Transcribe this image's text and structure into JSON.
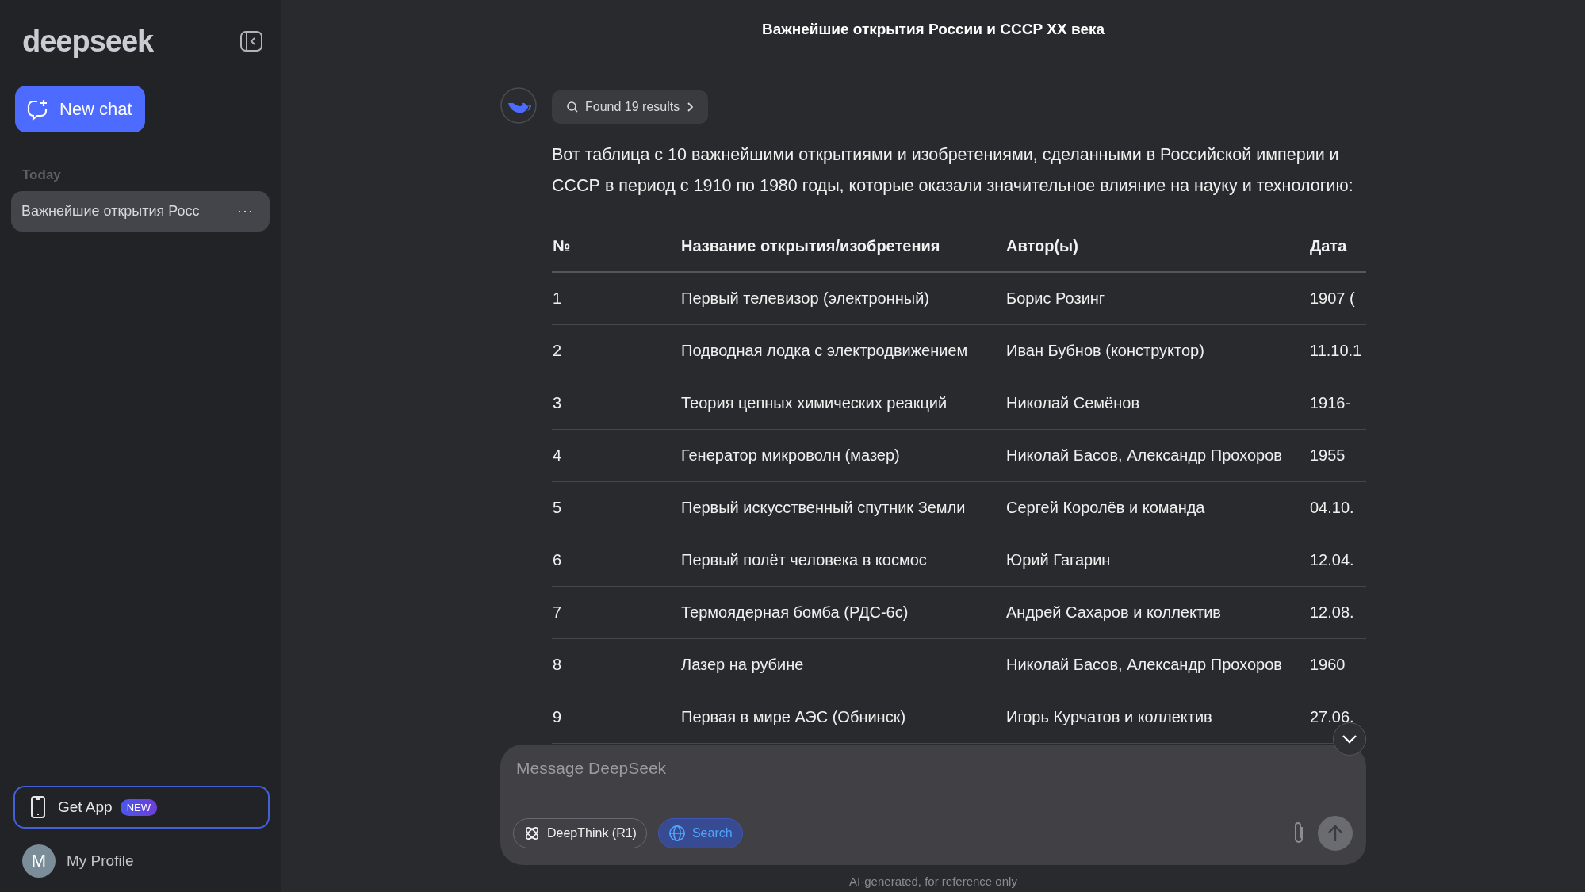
{
  "sidebar": {
    "logo": "deepseek",
    "new_chat": "New chat",
    "section": "Today",
    "history": [
      {
        "title": "Важнейшие открытия Росс",
        "selected": true,
        "menu": "···"
      }
    ],
    "get_app": {
      "label": "Get App",
      "badge": "NEW"
    },
    "profile": {
      "initial": "M",
      "name": "My Profile"
    }
  },
  "chat": {
    "title": "Важнейшие открытия России и СССР XX века",
    "search_chip": "Found 19 results",
    "intro": "Вот таблица с 10 важнейшими открытиями и изобретениями, сделанными в Российской империи и СССР в период с 1910 по 1980 годы, которые оказали значительное влияние на науку и технологию:",
    "table": {
      "columns": [
        "№",
        "Название открытия/изобретения",
        "Автор(ы)",
        "Дата"
      ],
      "rows": [
        [
          "1",
          "Первый телевизор (электронный)",
          "Борис Розинг",
          "1907 ("
        ],
        [
          "2",
          "Подводная лодка с электродвижением",
          "Иван Бубнов (конструктор)",
          "11.10.1"
        ],
        [
          "3",
          "Теория цепных химических реакций",
          "Николай Семёнов",
          "1916-"
        ],
        [
          "4",
          "Генератор микроволн (мазер)",
          "Николай Басов, Александр Прохоров",
          "1955"
        ],
        [
          "5",
          "Первый искусственный спутник Земли",
          "Сергей Королёв и команда",
          "04.10."
        ],
        [
          "6",
          "Первый полёт человека в космос",
          "Юрий Гагарин",
          "12.04."
        ],
        [
          "7",
          "Термоядерная бомба (РДС-6с)",
          "Андрей Сахаров и коллектив",
          "12.08."
        ],
        [
          "8",
          "Лазер на рубине",
          "Николай Басов, Александр Прохоров",
          "1960"
        ],
        [
          "9",
          "Первая в мире АЭС (Обнинск)",
          "Игорь Курчатов и коллектив",
          "27.06."
        ]
      ]
    }
  },
  "composer": {
    "placeholder": "Message DeepSeek",
    "toggles": [
      {
        "label": "DeepThink (R1)",
        "kind": "deepthink",
        "selected": false
      },
      {
        "label": "Search",
        "kind": "search",
        "selected": true
      }
    ]
  },
  "footer": "AI-generated, for reference only"
}
